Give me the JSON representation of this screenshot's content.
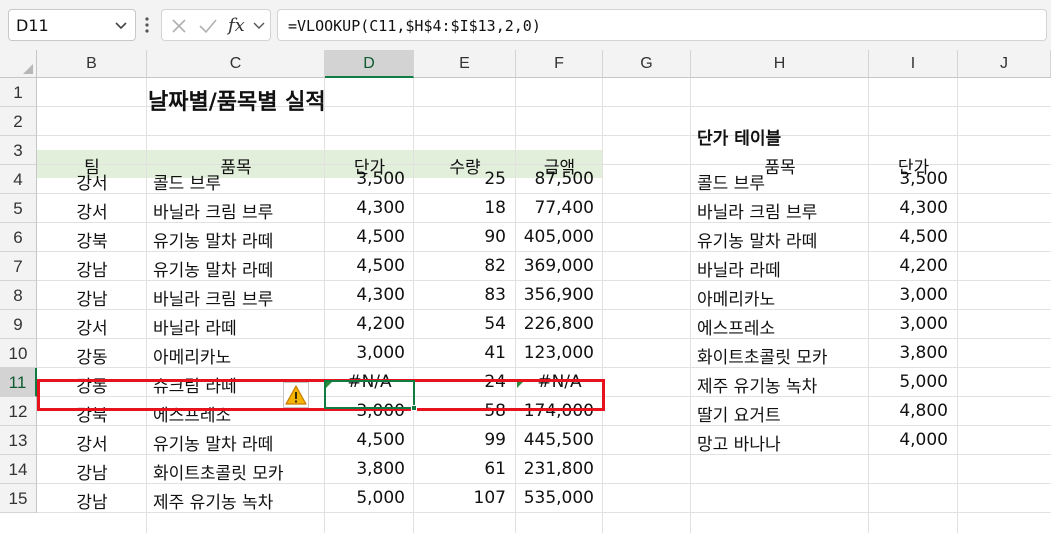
{
  "formula_bar": {
    "name_box": "D11",
    "formula": "=VLOOKUP(C11,$H$4:$I$13,2,0)"
  },
  "columns": [
    "B",
    "C",
    "D",
    "E",
    "F",
    "G",
    "H",
    "I",
    "J"
  ],
  "rows": [
    "1",
    "2",
    "3",
    "4",
    "5",
    "6",
    "7",
    "8",
    "9",
    "10",
    "11",
    "12",
    "13",
    "14",
    "15"
  ],
  "sheet": {
    "title": "날짜별/품목별 실적",
    "headers": {
      "team": "팀",
      "item": "품목",
      "price": "단가",
      "qty": "수량",
      "amount": "금액"
    },
    "data": [
      {
        "team": "강서",
        "item": "콜드 브루",
        "price": "3,500",
        "qty": "25",
        "amount": "87,500"
      },
      {
        "team": "강서",
        "item": "바닐라 크림 브루",
        "price": "4,300",
        "qty": "18",
        "amount": "77,400"
      },
      {
        "team": "강북",
        "item": "유기농 말차 라떼",
        "price": "4,500",
        "qty": "90",
        "amount": "405,000"
      },
      {
        "team": "강남",
        "item": "유기농 말차 라떼",
        "price": "4,500",
        "qty": "82",
        "amount": "369,000"
      },
      {
        "team": "강남",
        "item": "바닐라 크림 브루",
        "price": "4,300",
        "qty": "83",
        "amount": "356,900"
      },
      {
        "team": "강서",
        "item": "바닐라 라떼",
        "price": "4,200",
        "qty": "54",
        "amount": "226,800"
      },
      {
        "team": "강동",
        "item": "아메리카노",
        "price": "3,000",
        "qty": "41",
        "amount": "123,000"
      },
      {
        "team": "강동",
        "item": "슈크림 라떼",
        "price": "#N/A",
        "qty": "24",
        "amount": "#N/A"
      },
      {
        "team": "강북",
        "item": "에스프레소",
        "price": "3,000",
        "qty": "58",
        "amount": "174,000"
      },
      {
        "team": "강서",
        "item": "유기농 말차 라떼",
        "price": "4,500",
        "qty": "99",
        "amount": "445,500"
      },
      {
        "team": "강남",
        "item": "화이트초콜릿 모카",
        "price": "3,800",
        "qty": "61",
        "amount": "231,800"
      },
      {
        "team": "강남",
        "item": "제주 유기농 녹차",
        "price": "5,000",
        "qty": "107",
        "amount": "535,000"
      }
    ],
    "price_table": {
      "title": "단가 테이블",
      "headers": {
        "item": "품목",
        "price": "단가"
      },
      "rows": [
        {
          "item": "콜드 브루",
          "price": "3,500"
        },
        {
          "item": "바닐라 크림 브루",
          "price": "4,300"
        },
        {
          "item": "유기농 말차 라떼",
          "price": "4,500"
        },
        {
          "item": "바닐라 라떼",
          "price": "4,200"
        },
        {
          "item": "아메리카노",
          "price": "3,000"
        },
        {
          "item": "에스프레소",
          "price": "3,000"
        },
        {
          "item": "화이트초콜릿 모카",
          "price": "3,800"
        },
        {
          "item": "제주 유기농 녹차",
          "price": "5,000"
        },
        {
          "item": "딸기 요거트",
          "price": "4,800"
        },
        {
          "item": "망고 바나나",
          "price": "4,000"
        }
      ]
    }
  },
  "colors": {
    "header_band": "#e2efda",
    "selection": "#107c41",
    "error_highlight": "#e8121e",
    "warning": "#f4b400"
  },
  "icons": [
    "chevron-down-icon",
    "kebab-icon",
    "cancel-icon",
    "enter-icon",
    "fx-icon",
    "warning-icon"
  ]
}
